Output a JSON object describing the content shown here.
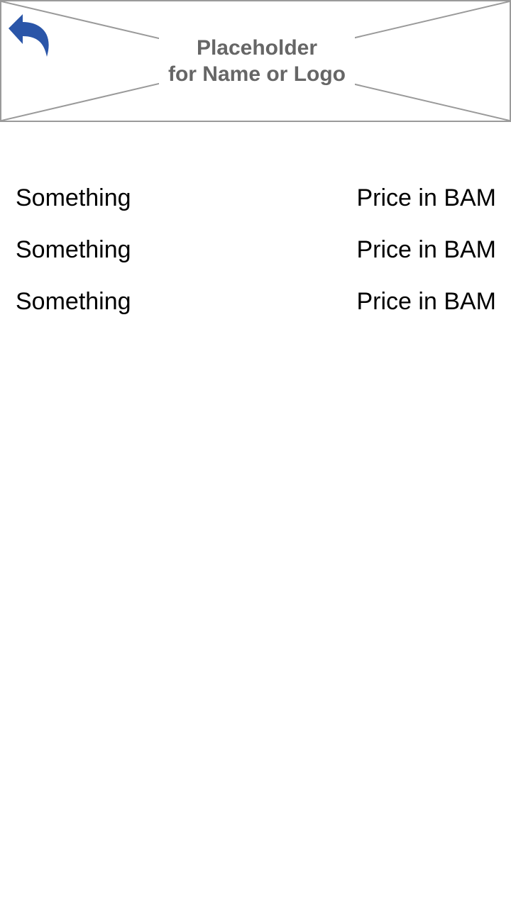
{
  "header": {
    "logo_line1": "Placeholder",
    "logo_line2": "for Name or Logo",
    "back_icon": "back-arrow-icon",
    "back_icon_color": "#2a55a8"
  },
  "items": [
    {
      "name": "Something",
      "price": "Price in BAM"
    },
    {
      "name": "Something",
      "price": "Price in BAM"
    },
    {
      "name": "Something",
      "price": "Price in BAM"
    }
  ]
}
